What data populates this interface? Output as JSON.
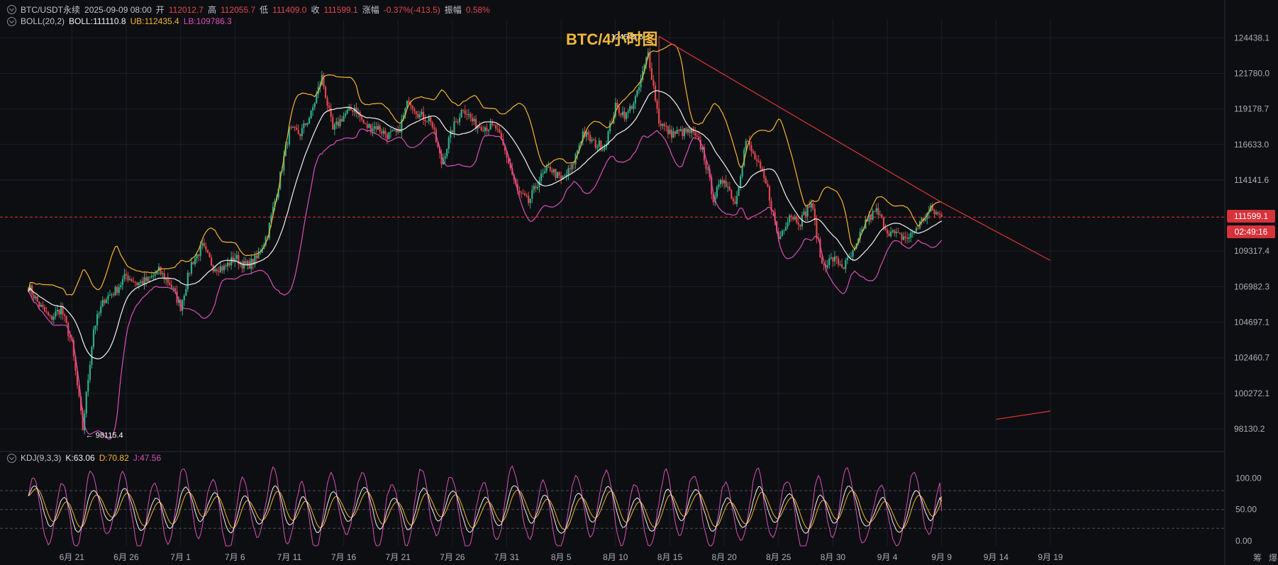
{
  "header": {
    "symbol": "BTC/USDT永续",
    "datetime": "2025-09-09 08:00",
    "open_label": "开",
    "open": "112012.7",
    "high_label": "高",
    "high": "112055.7",
    "low_label": "低",
    "low": "111409.0",
    "close_label": "收",
    "close": "111599.1",
    "change_label": "涨幅",
    "change": "-0.37%(-413.5)",
    "amp_label": "振幅",
    "amp": "0.58%"
  },
  "boll": {
    "label": "BOLL(20,2)",
    "mid": "BOLL:111110.8",
    "ub": "UB:112435.4",
    "lb": "LB:109786.3"
  },
  "kdj": {
    "label": "KDJ(9,3,3)",
    "k": "K:63.06",
    "d": "D:70.82",
    "j": "J:47.56"
  },
  "chart_title": "BTC/4小时图",
  "price_tag": "111599.1",
  "countdown_tag": "02:49:16",
  "corner_labels": [
    "筹",
    "爆"
  ],
  "colors": {
    "up": "#2fae87",
    "down": "#e0474c",
    "mid": "#f2f2f2",
    "ub": "#f5b52b",
    "lb": "#d94fb8",
    "trend": "#e0343a",
    "title": "#f2b83a"
  },
  "chart_data": [
    {
      "type": "candlestick",
      "title": "BTC/4小时图",
      "x_tick_labels": [
        "6月 21",
        "6月 26",
        "7月 1",
        "7月 6",
        "7月 11",
        "7月 16",
        "7月 21",
        "7月 26",
        "7月 31",
        "8月 5",
        "8月 10",
        "8月 15",
        "8月 20",
        "8月 25",
        "8月 30",
        "9月 4",
        "9月 9",
        "9月 14",
        "9月 19"
      ],
      "y_tick_labels": [
        "124438.1",
        "121780.0",
        "119178.7",
        "116633.0",
        "114141.6",
        "111599.1",
        "109317.4",
        "106982.3",
        "104697.1",
        "102460.7",
        "100272.1",
        "98130.2"
      ],
      "yscale": "log",
      "ylim": [
        97500,
        125800
      ],
      "annotations": [
        {
          "text": "124545.6",
          "date": "8月 14",
          "price": 124545.6,
          "kind": "high"
        },
        {
          "text": "98115.4",
          "date": "6月 22",
          "price": 98115.4,
          "kind": "low"
        }
      ],
      "last_price": 111599.1,
      "trendline": [
        {
          "date": "8月 14",
          "price": 124545.6
        },
        {
          "date": "9月 9",
          "price": 112600
        },
        {
          "date": "9月 19",
          "price": 108700
        }
      ],
      "trendline_2": [
        {
          "date": "9月 14",
          "price": 98700
        },
        {
          "date": "9月 19",
          "price": 99200
        }
      ],
      "close_path": [
        {
          "date": "6月 17",
          "close": 107000
        },
        {
          "date": "6月 18",
          "close": 105800
        },
        {
          "date": "6月 19",
          "close": 104900
        },
        {
          "date": "6月 20",
          "close": 105600
        },
        {
          "date": "6月 21",
          "close": 103300
        },
        {
          "date": "6月 22",
          "close": 98115
        },
        {
          "date": "6月 23",
          "close": 104300
        },
        {
          "date": "6月 24",
          "close": 106200
        },
        {
          "date": "6月 25",
          "close": 106700
        },
        {
          "date": "6月 26",
          "close": 107700
        },
        {
          "date": "6月 27",
          "close": 107200
        },
        {
          "date": "6月 28",
          "close": 107400
        },
        {
          "date": "6月 29",
          "close": 108000
        },
        {
          "date": "6月 30",
          "close": 107200
        },
        {
          "date": "7月 1",
          "close": 105700
        },
        {
          "date": "7月 2",
          "close": 108500
        },
        {
          "date": "7月 3",
          "close": 109600
        },
        {
          "date": "7月 4",
          "close": 108300
        },
        {
          "date": "7月 5",
          "close": 108200
        },
        {
          "date": "7月 6",
          "close": 108900
        },
        {
          "date": "7月 7",
          "close": 108300
        },
        {
          "date": "7月 8",
          "close": 108800
        },
        {
          "date": "7月 9",
          "close": 110500
        },
        {
          "date": "7月 10",
          "close": 113800
        },
        {
          "date": "7月 11",
          "close": 117600
        },
        {
          "date": "7月 12",
          "close": 117400
        },
        {
          "date": "7月 13",
          "close": 118800
        },
        {
          "date": "7月 14",
          "close": 121500
        },
        {
          "date": "7月 15",
          "close": 117600
        },
        {
          "date": "7月 16",
          "close": 118700
        },
        {
          "date": "7月 17",
          "close": 119300
        },
        {
          "date": "7月 18",
          "close": 117900
        },
        {
          "date": "7月 19",
          "close": 117900
        },
        {
          "date": "7月 20",
          "close": 117300
        },
        {
          "date": "7月 21",
          "close": 117400
        },
        {
          "date": "7月 22",
          "close": 119900
        },
        {
          "date": "7月 23",
          "close": 118700
        },
        {
          "date": "7月 24",
          "close": 118400
        },
        {
          "date": "7月 25",
          "close": 115300
        },
        {
          "date": "7月 26",
          "close": 117700
        },
        {
          "date": "7月 27",
          "close": 119300
        },
        {
          "date": "7月 28",
          "close": 118100
        },
        {
          "date": "7月 29",
          "close": 117900
        },
        {
          "date": "7月 30",
          "close": 117800
        },
        {
          "date": "7月 31",
          "close": 115800
        },
        {
          "date": "8月 1",
          "close": 113300
        },
        {
          "date": "8月 2",
          "close": 112600
        },
        {
          "date": "8月 3",
          "close": 114200
        },
        {
          "date": "8月 4",
          "close": 115000
        },
        {
          "date": "8月 5",
          "close": 114100
        },
        {
          "date": "8月 6",
          "close": 115000
        },
        {
          "date": "8月 7",
          "close": 117500
        },
        {
          "date": "8月 8",
          "close": 116700
        },
        {
          "date": "8月 9",
          "close": 116500
        },
        {
          "date": "8月 10",
          "close": 119300
        },
        {
          "date": "8月 11",
          "close": 118700
        },
        {
          "date": "8月 12",
          "close": 120200
        },
        {
          "date": "8月 13",
          "close": 123300
        },
        {
          "date": "8月 14",
          "close": 118300
        },
        {
          "date": "8月 15",
          "close": 117400
        },
        {
          "date": "8月 16",
          "close": 117500
        },
        {
          "date": "8月 17",
          "close": 117500
        },
        {
          "date": "8月 18",
          "close": 116300
        },
        {
          "date": "8月 19",
          "close": 112900
        },
        {
          "date": "8月 20",
          "close": 114300
        },
        {
          "date": "8月 21",
          "close": 112500
        },
        {
          "date": "8月 22",
          "close": 116900
        },
        {
          "date": "8月 23",
          "close": 115400
        },
        {
          "date": "8月 24",
          "close": 113500
        },
        {
          "date": "8月 25",
          "close": 110100
        },
        {
          "date": "8月 26",
          "close": 111800
        },
        {
          "date": "8月 27",
          "close": 111300
        },
        {
          "date": "8月 28",
          "close": 112600
        },
        {
          "date": "8月 29",
          "close": 108400
        },
        {
          "date": "8月 30",
          "close": 108800
        },
        {
          "date": "8月 31",
          "close": 108300
        },
        {
          "date": "9月 1",
          "close": 109300
        },
        {
          "date": "9月 2",
          "close": 111300
        },
        {
          "date": "9月 3",
          "close": 112000
        },
        {
          "date": "9月 4",
          "close": 110700
        },
        {
          "date": "9月 5",
          "close": 110300
        },
        {
          "date": "9月 6",
          "close": 110200
        },
        {
          "date": "9月 7",
          "close": 111200
        },
        {
          "date": "9月 8",
          "close": 112100
        },
        {
          "date": "9月 9",
          "close": 111599
        }
      ]
    },
    {
      "type": "line",
      "title": "KDJ(9,3,3)",
      "y_tick_labels": [
        "100.00",
        "50.00",
        "0.00"
      ],
      "ylim": [
        -8,
        122
      ],
      "series": [
        {
          "name": "K",
          "last": 63.06,
          "color": "#f2f2f2"
        },
        {
          "name": "D",
          "last": 70.82,
          "color": "#f5b52b"
        },
        {
          "name": "J",
          "last": 47.56,
          "color": "#d94fb8"
        }
      ]
    }
  ]
}
